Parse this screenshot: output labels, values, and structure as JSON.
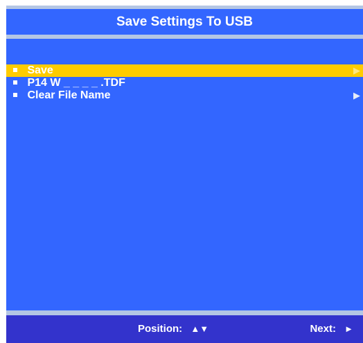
{
  "title": "Save Settings To USB",
  "menu": [
    {
      "label": "Save",
      "has_arrow": true,
      "selected": true
    },
    {
      "label": "P14 W _ _ _ _ .TDF",
      "has_arrow": false,
      "selected": false
    },
    {
      "label": "Clear File Name",
      "has_arrow": true,
      "selected": false
    }
  ],
  "footer": {
    "position_label": "Position:",
    "position_icon": "▲▼",
    "next_label": "Next:",
    "next_icon": "►"
  },
  "icons": {
    "bullet": "square-bullet-icon",
    "arrow": "right-triangle-icon"
  },
  "colors": {
    "background": "#3366ff",
    "selection": "#ffcc00",
    "divider": "#b4c6e4",
    "footer": "#3333cc",
    "text": "#ffffff"
  }
}
